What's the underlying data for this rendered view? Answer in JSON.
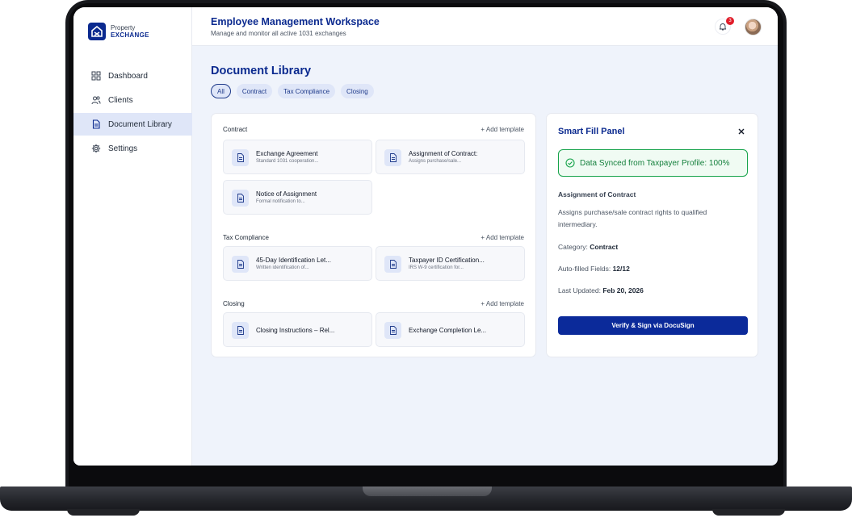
{
  "app": {
    "logo_line1": "Property",
    "logo_line2": "EXCHANGE",
    "title": "Employee Management Workspace",
    "subtitle": "Manage and monitor all active 1031 exchanges",
    "notification_count": "3"
  },
  "sidebar": {
    "items": [
      {
        "label": "Dashboard",
        "icon": "dashboard-icon"
      },
      {
        "label": "Clients",
        "icon": "users-icon"
      },
      {
        "label": "Document Library",
        "icon": "document-icon",
        "active": true
      },
      {
        "label": "Settings",
        "icon": "gear-icon"
      }
    ]
  },
  "library": {
    "title": "Document Library",
    "filters": [
      "All",
      "Contract",
      "Tax Compliance",
      "Closing"
    ],
    "add_label": "+ Add template",
    "sections": [
      {
        "name": "Contract",
        "docs": [
          {
            "title": "Exchange Agreement",
            "desc": "Standard 1031 cooperation..."
          },
          {
            "title": "Assignment of Contract:",
            "desc": "Assigns purchase/sale..."
          },
          {
            "title": "Notice of Assignment",
            "desc": "Formal notification to..."
          }
        ]
      },
      {
        "name": "Tax Compliance",
        "docs": [
          {
            "title": "45-Day Identification Let...",
            "desc": "Written identification of..."
          },
          {
            "title": "Taxpayer ID Certification...",
            "desc": "IRS W-9 certification for..."
          }
        ]
      },
      {
        "name": "Closing",
        "docs": [
          {
            "title": "Closing Instructions – Rel...",
            "desc": ""
          },
          {
            "title": "Exchange Completion Le...",
            "desc": ""
          }
        ]
      }
    ]
  },
  "panel": {
    "title": "Smart Fill Panel",
    "sync_text": "Data Synced from Taxpayer Profile: 100%",
    "doc_name": "Assignment of Contract",
    "doc_desc": "Assigns purchase/sale contract rights to qualified intermediary.",
    "category_label": "Category:",
    "category_value": "Contract",
    "fields_label": "Auto-filled Fields:",
    "fields_value": "12/12",
    "updated_label": "Last Updated:",
    "updated_value": "Feb 20, 2026",
    "cta_label": "Verify & Sign via DocuSign"
  },
  "colors": {
    "brand": "#0b2a8f",
    "success": "#16a34a",
    "badge": "#e11d2a"
  }
}
